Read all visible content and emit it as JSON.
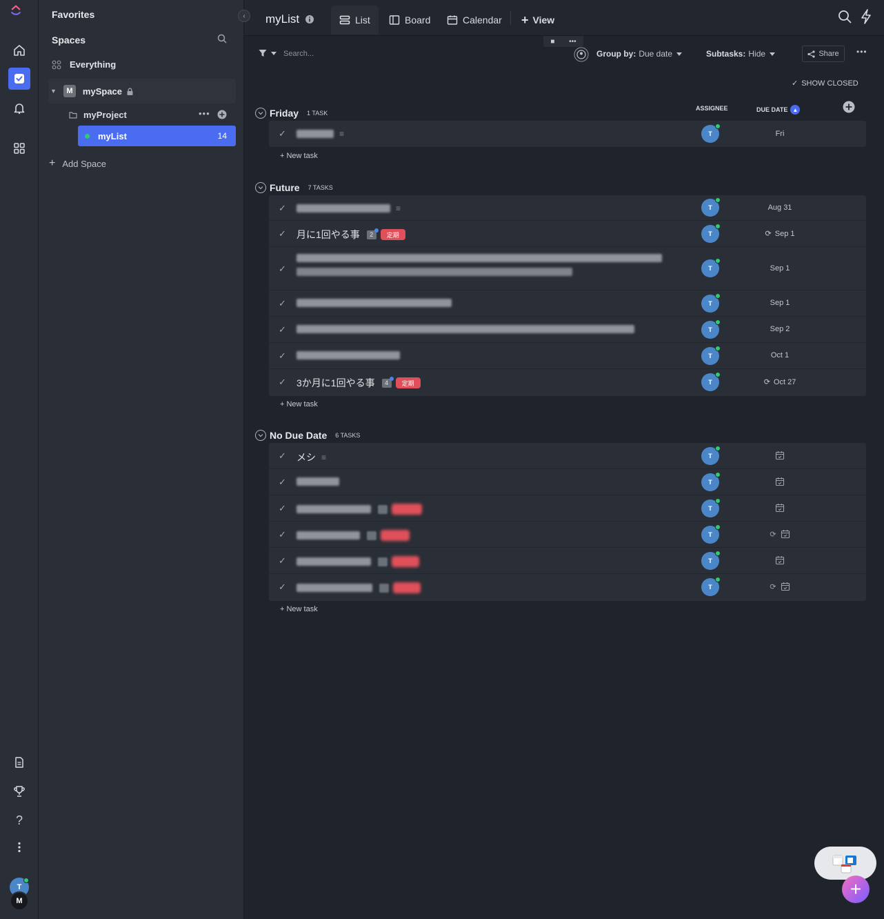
{
  "sidebar": {
    "favorites": "Favorites",
    "spaces": "Spaces",
    "everything": "Everything",
    "space_initial": "M",
    "space_name": "mySpace",
    "project": "myProject",
    "list_name": "myList",
    "list_count": "14",
    "add_space": "Add Space"
  },
  "rail": {
    "user_initial_t": "T",
    "user_initial_m": "M"
  },
  "header": {
    "title": "myList",
    "tabs": [
      "List",
      "Board",
      "Calendar"
    ],
    "add_view": "View"
  },
  "filter": {
    "search_placeholder": "Search...",
    "group_by_label": "Group by:",
    "group_by_value": "Due date",
    "subtasks_label": "Subtasks:",
    "subtasks_value": "Hide",
    "share": "Share",
    "show_closed": "SHOW CLOSED"
  },
  "columns": {
    "assignee": "ASSIGNEE",
    "due_date": "DUE DATE"
  },
  "new_task": "+ New task",
  "groups": [
    {
      "name": "Friday",
      "count": "1 TASK",
      "tasks": [
        {
          "due": "Fri",
          "assignee": "T"
        }
      ]
    },
    {
      "name": "Future",
      "count": "7 TASKS",
      "tasks": [
        {
          "due": "Aug 31",
          "assignee": "T"
        },
        {
          "name": "月に1回やる事",
          "subtasks": "2",
          "tag": "定期",
          "due": "Sep 1",
          "recurring": true,
          "assignee": "T"
        },
        {
          "due": "Sep 1",
          "assignee": "T"
        },
        {
          "due": "Sep 1",
          "assignee": "T"
        },
        {
          "due": "Sep 2",
          "assignee": "T"
        },
        {
          "due": "Oct 1",
          "assignee": "T"
        },
        {
          "name": "3か月に1回やる事",
          "subtasks": "4",
          "tag": "定期",
          "due": "Oct 27",
          "recurring": true,
          "assignee": "T"
        }
      ]
    },
    {
      "name": "No Due Date",
      "count": "6 TASKS",
      "tasks": [
        {
          "name": "メシ",
          "assignee": "T"
        },
        {
          "assignee": "T"
        },
        {
          "assignee": "T"
        },
        {
          "assignee": "T",
          "recurring": true
        },
        {
          "assignee": "T"
        },
        {
          "assignee": "T",
          "recurring": true
        }
      ]
    }
  ],
  "colors": {
    "accent": "#4a6cf0",
    "tag_red": "#e0505a",
    "assignee": "#4a86c8",
    "online": "#2ecc71"
  }
}
